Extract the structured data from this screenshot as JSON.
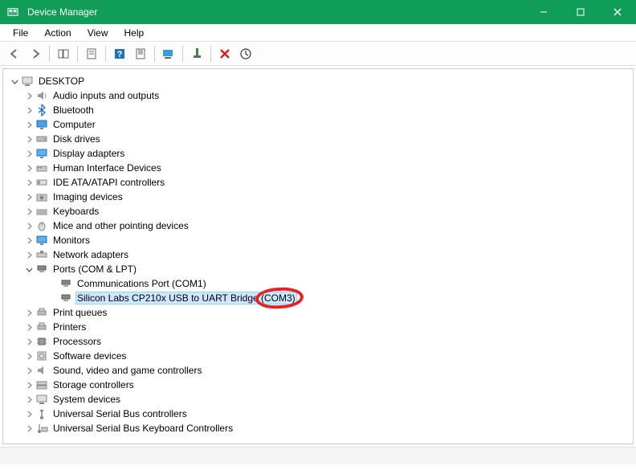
{
  "window": {
    "title": "Device Manager"
  },
  "menu": {
    "file": "File",
    "action": "Action",
    "view": "View",
    "help": "Help"
  },
  "tree": {
    "root": "DESKTOP",
    "nodes": {
      "audio": "Audio inputs and outputs",
      "bluetooth": "Bluetooth",
      "computer": "Computer",
      "disk": "Disk drives",
      "display": "Display adapters",
      "hid": "Human Interface Devices",
      "ide": "IDE ATA/ATAPI controllers",
      "imaging": "Imaging devices",
      "keyboards": "Keyboards",
      "mice": "Mice and other pointing devices",
      "monitors": "Monitors",
      "network": "Network adapters",
      "ports": {
        "label": "Ports (COM & LPT)",
        "children": {
          "com1": "Communications Port (COM1)",
          "com3": "Silicon Labs CP210x USB to UART Bridge (COM3)"
        }
      },
      "printq": "Print queues",
      "printers": "Printers",
      "processors": "Processors",
      "software": "Software devices",
      "sound": "Sound, video and game controllers",
      "storage": "Storage controllers",
      "system": "System devices",
      "usb": "Universal Serial Bus controllers",
      "usbkb": "Universal Serial Bus Keyboard Controllers"
    }
  }
}
